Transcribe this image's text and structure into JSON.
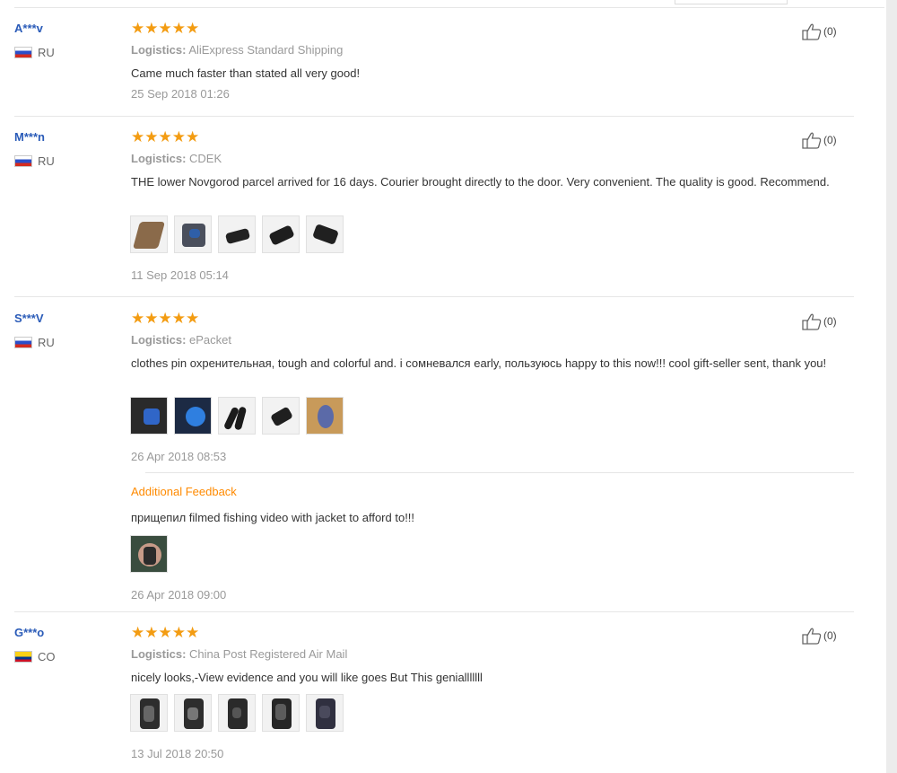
{
  "reviews": [
    {
      "user": "A***v",
      "country": "RU",
      "stars": "★★★★★",
      "logistics_label": "Logistics:",
      "logistics": "AliExpress Standard Shipping",
      "text": "Came much faster than stated all very good!",
      "date": "25 Sep 2018 01:26",
      "likes": "(0)"
    },
    {
      "user": "M***n",
      "country": "RU",
      "stars": "★★★★★",
      "logistics_label": "Logistics:",
      "logistics": "CDEK",
      "text": "THE lower Novgorod parcel arrived for 16 days. Courier brought directly to the door. Very convenient. The quality is good. Recommend.",
      "date": "11 Sep 2018 05:14",
      "likes": "(0)"
    },
    {
      "user": "S***V",
      "country": "RU",
      "stars": "★★★★★",
      "logistics_label": "Logistics:",
      "logistics": "ePacket",
      "text": "clothes pin охренительная, tough and colorful and. i сомневался early, пользуюсь happy to this now!!! cool gift-seller sent, thank you!",
      "date": "26 Apr 2018 08:53",
      "likes": "(0)",
      "additional_title": "Additional Feedback",
      "additional_text": "прищепил filmed fishing video with jacket to afford to!!!",
      "additional_date": "26 Apr 2018 09:00"
    },
    {
      "user": "G***o",
      "country": "CO",
      "stars": "★★★★★",
      "logistics_label": "Logistics:",
      "logistics": "China Post Registered Air Mail",
      "text": "nicely looks,-View evidence and you will like goes But This genialllllll",
      "date": "13 Jul 2018 20:50",
      "likes": "(0)"
    }
  ],
  "icons": {
    "like": "thumbs-up-icon",
    "flag_ru": "russia-flag-icon",
    "flag_co": "colombia-flag-icon"
  },
  "colors": {
    "stars": "#f39c12",
    "username": "#2a5bb8",
    "additional": "#ff8a00"
  }
}
